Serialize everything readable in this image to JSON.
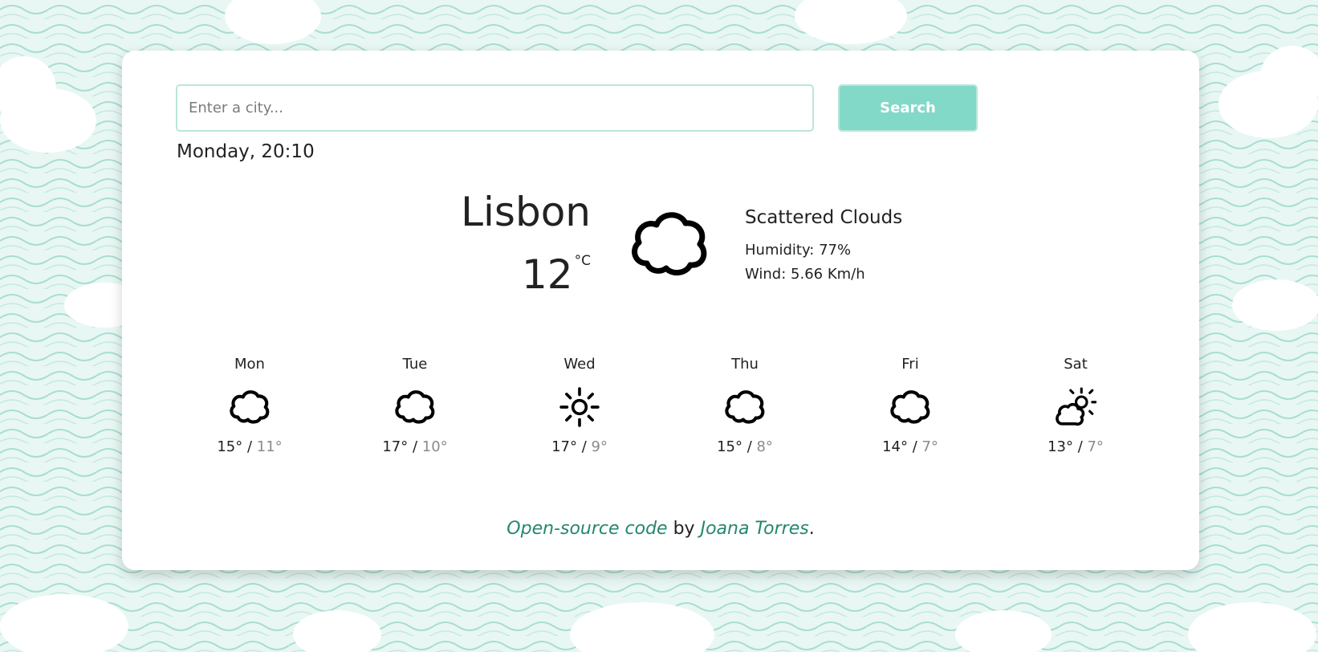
{
  "search": {
    "placeholder": "Enter a city...",
    "value": "",
    "button_label": "Search"
  },
  "current": {
    "datetime": "Monday, 20:10",
    "city": "Lisbon",
    "temperature": "12",
    "unit": "°C",
    "description": "Scattered Clouds",
    "humidity": "Humidity: 77%",
    "wind": "Wind: 5.66 Km/h",
    "icon": "cloud-icon"
  },
  "forecast": [
    {
      "day": "Mon",
      "max": "15°",
      "min": "11°",
      "icon": "cloud-icon"
    },
    {
      "day": "Tue",
      "max": "17°",
      "min": "10°",
      "icon": "cloud-icon"
    },
    {
      "day": "Wed",
      "max": "17°",
      "min": "9°",
      "icon": "sun-icon"
    },
    {
      "day": "Thu",
      "max": "15°",
      "min": "8°",
      "icon": "cloud-icon"
    },
    {
      "day": "Fri",
      "max": "14°",
      "min": "7°",
      "icon": "cloud-icon"
    },
    {
      "day": "Sat",
      "max": "13°",
      "min": "7°",
      "icon": "partly-cloudy-icon"
    }
  ],
  "temp_separator": " / ",
  "footer": {
    "link1_text": "Open-source code",
    "middle_text": " by ",
    "link2_text": "Joana Torres",
    "end_text": "."
  },
  "colors": {
    "accent": "#83d9c8",
    "link": "#24876e",
    "background": "#dff3ef"
  }
}
